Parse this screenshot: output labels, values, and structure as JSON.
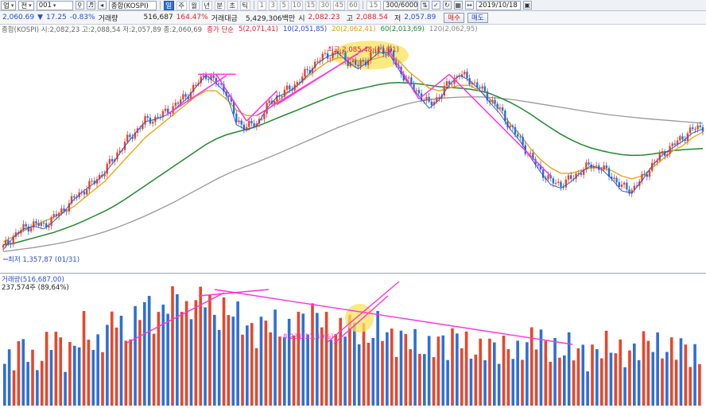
{
  "toolbar": {
    "market_select": "업",
    "view_select": "전",
    "code_value": "001",
    "index_name": "종합(KOSPI)",
    "periods": [
      "일",
      "주",
      "월",
      "년",
      "분",
      "초",
      "틱"
    ],
    "active_period": "일",
    "intervals": [
      "1",
      "3",
      "5",
      "10",
      "15",
      "30",
      "45",
      "60"
    ],
    "interval_extra": "15",
    "count_value": "300/6000",
    "date_value": "2019/10/18"
  },
  "quote": {
    "price": "2,060.69",
    "direction_icon": "triangle-down-icon",
    "change": "17.25",
    "change_pct": "-0.83%",
    "volume_label": "거래량",
    "volume_value": "516,687",
    "volume_pct": "164.47%",
    "amount_label": "거래대금",
    "amount_value": "5,429,306백만",
    "open_label": "시",
    "open_value": "2,082.23",
    "high_label": "고",
    "high_value": "2,088.54",
    "low_label": "저",
    "low_value": "2,057.89",
    "buy_label": "매수",
    "sell_label": "매도"
  },
  "legend": {
    "ohlc_text": "종합(KOSPI) 시:2,082,23 고:2,088,54 저:2,057,89 종:2,060,69",
    "ma_prefix": "종가 단순",
    "ma5": "5(2,071,41)",
    "ma10": "10(2,051,85)",
    "ma20": "20(2,062,41)",
    "ma60": "60(2,013,69)",
    "ma120": "120(2,062,95)"
  },
  "annotations": {
    "high_marker": "최고 2,085,48 (11/01)",
    "low_marker": "최저 1,357,87 (01/31)"
  },
  "volume_panel": {
    "legend_text": "거래량(516,687,00)",
    "sub_text": "237,574주 (89,64%)",
    "mid_marker": "8,231(21,40%)"
  },
  "colors": {
    "up": "#e8462a",
    "down": "#2d6fd8",
    "ma5": "#e01f2b",
    "ma10": "#2a4fc8",
    "ma20": "#f0a418",
    "ma60": "#1f8a2e",
    "ma120": "#999999",
    "trendline": "#ff33dd",
    "highlight": "#f7e35a"
  },
  "chart_data": {
    "type": "candlestick",
    "price_range": [
      1300,
      2130
    ],
    "ohlc_summary": {
      "open": 2082.23,
      "high": 2088.54,
      "low": 2057.89,
      "close": 2060.69
    },
    "all_time_high": 2085.48,
    "all_time_low": 1357.87,
    "close_path": [
      1360,
      1400,
      1430,
      1445,
      1440,
      1470,
      1500,
      1540,
      1570,
      1600,
      1640,
      1690,
      1740,
      1780,
      1820,
      1830,
      1850,
      1880,
      1910,
      1950,
      1990,
      1960,
      1930,
      1820,
      1800,
      1810,
      1870,
      1910,
      1930,
      1960,
      2000,
      2040,
      2060,
      2070,
      2040,
      2020,
      2050,
      2080,
      2075,
      2010,
      1960,
      1920,
      1880,
      1910,
      1960,
      1990,
      1970,
      1940,
      1900,
      1860,
      1800,
      1750,
      1690,
      1640,
      1600,
      1590,
      1610,
      1640,
      1660,
      1650,
      1620,
      1580,
      1570,
      1610,
      1660,
      1700,
      1730,
      1760,
      1790,
      1800
    ],
    "ma20_path": [
      1380,
      1400,
      1420,
      1440,
      1455,
      1470,
      1490,
      1510,
      1540,
      1570,
      1600,
      1640,
      1680,
      1720,
      1760,
      1790,
      1820,
      1850,
      1880,
      1910,
      1930,
      1930,
      1900,
      1860,
      1840,
      1840,
      1860,
      1890,
      1920,
      1950,
      1980,
      2010,
      2035,
      2050,
      2050,
      2040,
      2040,
      2050,
      2060,
      2040,
      2000,
      1970,
      1940,
      1930,
      1940,
      1950,
      1950,
      1930,
      1900,
      1860,
      1810,
      1770,
      1720,
      1680,
      1650,
      1630,
      1630,
      1640,
      1650,
      1650,
      1640,
      1620,
      1610,
      1620,
      1650,
      1680,
      1710,
      1730,
      1760,
      1780
    ],
    "ma60_path": [
      1370,
      1375,
      1385,
      1395,
      1405,
      1415,
      1428,
      1442,
      1458,
      1475,
      1492,
      1512,
      1535,
      1560,
      1585,
      1610,
      1635,
      1660,
      1685,
      1710,
      1735,
      1755,
      1770,
      1780,
      1790,
      1800,
      1815,
      1830,
      1845,
      1860,
      1875,
      1890,
      1905,
      1918,
      1928,
      1936,
      1944,
      1952,
      1958,
      1960,
      1958,
      1955,
      1950,
      1945,
      1942,
      1940,
      1936,
      1930,
      1920,
      1905,
      1888,
      1868,
      1845,
      1820,
      1795,
      1772,
      1752,
      1735,
      1722,
      1712,
      1704,
      1698,
      1695,
      1696,
      1700,
      1706,
      1712,
      1716,
      1718,
      1720
    ],
    "ma120_path": [
      1345,
      1350,
      1355,
      1360,
      1366,
      1372,
      1379,
      1387,
      1396,
      1406,
      1417,
      1430,
      1444,
      1459,
      1475,
      1492,
      1510,
      1528,
      1548,
      1568,
      1588,
      1608,
      1626,
      1642,
      1656,
      1670,
      1685,
      1700,
      1716,
      1732,
      1748,
      1764,
      1780,
      1796,
      1810,
      1824,
      1837,
      1850,
      1862,
      1874,
      1884,
      1892,
      1898,
      1902,
      1905,
      1907,
      1908,
      1908,
      1906,
      1903,
      1899,
      1894,
      1888,
      1882,
      1876,
      1870,
      1864,
      1858,
      1852,
      1847,
      1842,
      1838,
      1834,
      1830,
      1827,
      1824,
      1821,
      1818,
      1815,
      1812
    ],
    "volume_relative": [
      0.35,
      0.42,
      0.55,
      0.3,
      0.48,
      0.62,
      0.4,
      0.5,
      0.7,
      0.45,
      0.6,
      0.8,
      0.55,
      0.72,
      0.9,
      0.68,
      0.85,
      1.0,
      0.75,
      0.88,
      0.95,
      0.7,
      0.82,
      0.78,
      0.65,
      0.6,
      0.72,
      0.68,
      0.58,
      0.75,
      0.7,
      0.8,
      0.66,
      0.6,
      0.72,
      0.64,
      0.55,
      0.68,
      0.6,
      0.52,
      0.6,
      0.5,
      0.46,
      0.55,
      0.5,
      0.62,
      0.48,
      0.44,
      0.52,
      0.46,
      0.5,
      0.42,
      0.55,
      0.6,
      0.48,
      0.44,
      0.5,
      0.46,
      0.4,
      0.48,
      0.52,
      0.45,
      0.42,
      0.5,
      0.56,
      0.48,
      0.46,
      0.52,
      0.44,
      0.38
    ],
    "xlabel": "",
    "ylabel": ""
  }
}
